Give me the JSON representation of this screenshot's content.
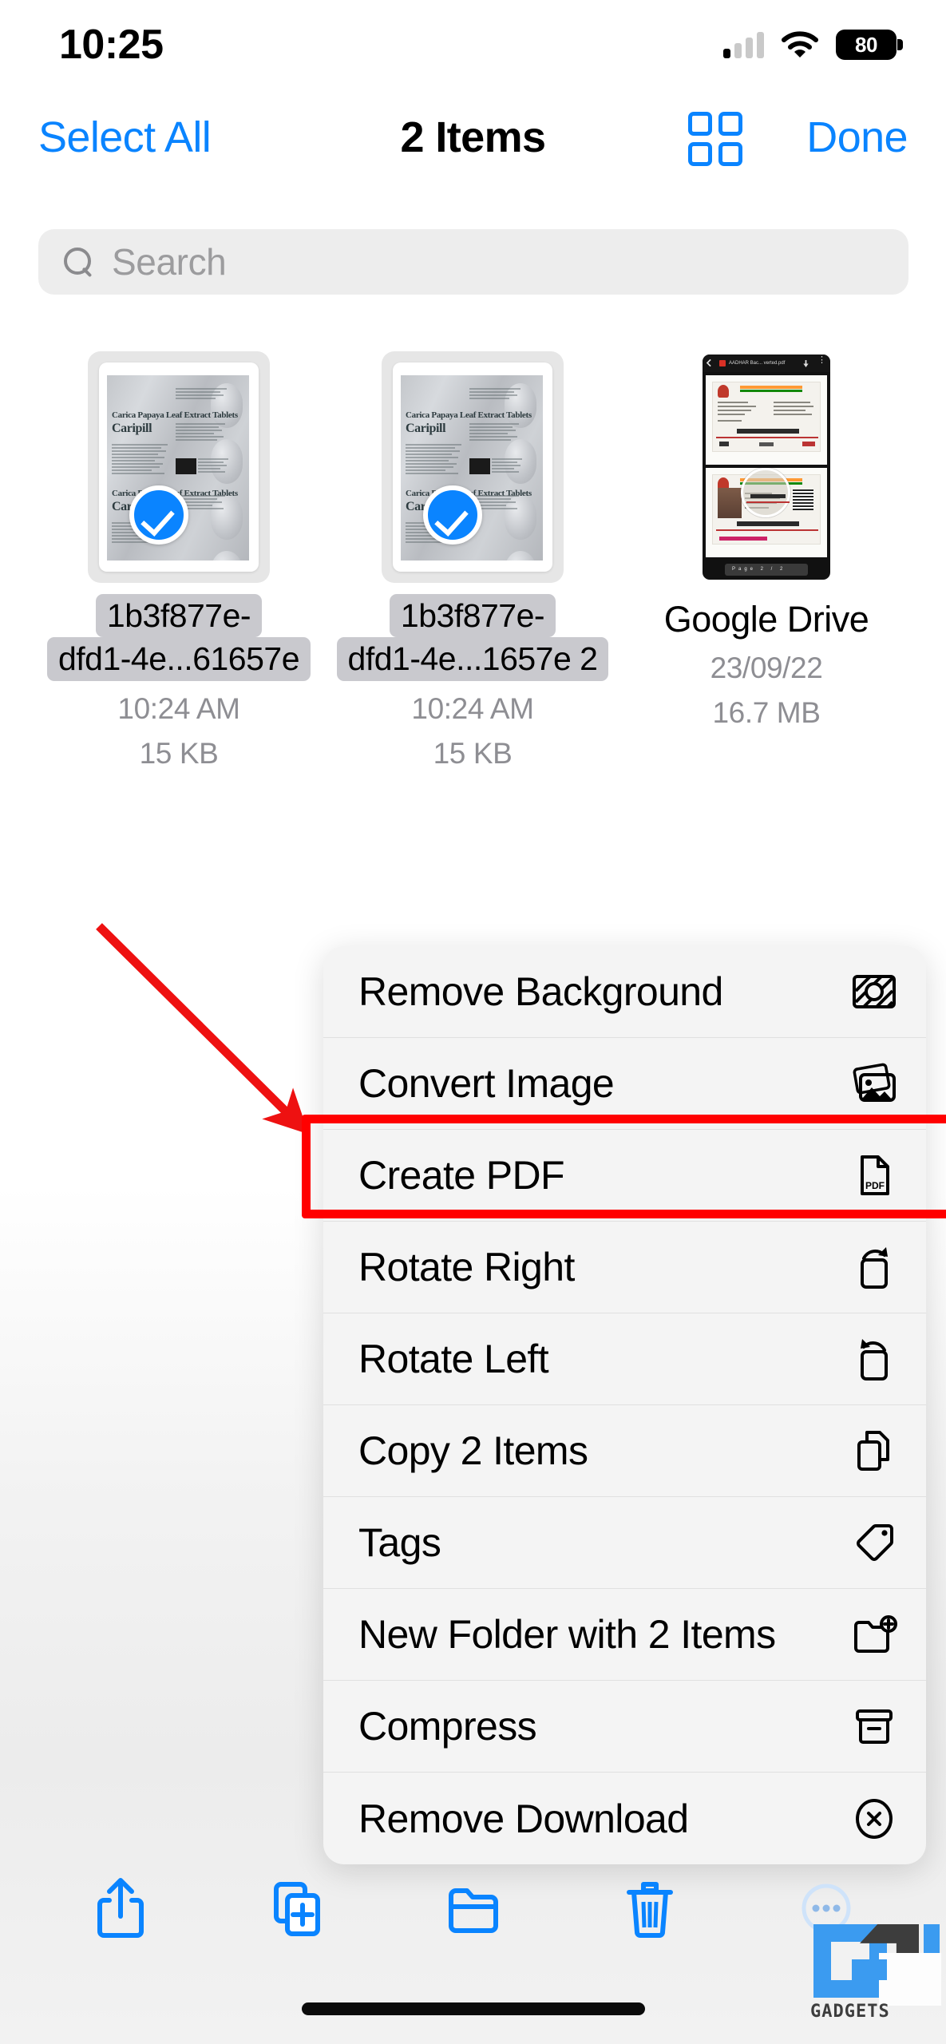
{
  "status_bar": {
    "time": "10:25",
    "battery_level": "80",
    "cellular_icon": "cellular-signal-icon",
    "wifi_icon": "wifi-icon",
    "battery_icon": "battery-icon"
  },
  "nav_bar": {
    "select_all_label": "Select All",
    "title": "2 Items",
    "grid_view_icon": "grid-view-icon",
    "done_label": "Done"
  },
  "search": {
    "placeholder": "Search",
    "icon": "search-icon"
  },
  "files": [
    {
      "name_line1": "1b3f877e-",
      "name_line2": "dfd1-4e...61657e",
      "time": "10:24 AM",
      "size": "15 KB",
      "selected": true,
      "thumbnail": "pill-blister-photo"
    },
    {
      "name_line1": "1b3f877e-",
      "name_line2": "dfd1-4e...1657e 2",
      "time": "10:24 AM",
      "size": "15 KB",
      "selected": true,
      "thumbnail": "pill-blister-photo"
    },
    {
      "name_line1": "Google Drive",
      "name_line2": "",
      "time": "23/09/22",
      "size": "16.7 MB",
      "selected": false,
      "thumbnail": "aadhaar-pdf-screenshot"
    }
  ],
  "context_menu": {
    "items": [
      {
        "label": "Remove Background",
        "icon": "remove-background-icon",
        "highlighted": false
      },
      {
        "label": "Convert Image",
        "icon": "convert-image-icon",
        "highlighted": false
      },
      {
        "label": "Create PDF",
        "icon": "create-pdf-icon",
        "highlighted": true
      },
      {
        "label": "Rotate Right",
        "icon": "rotate-right-icon",
        "highlighted": false
      },
      {
        "label": "Rotate Left",
        "icon": "rotate-left-icon",
        "highlighted": false
      },
      {
        "label": "Copy 2 Items",
        "icon": "copy-icon",
        "highlighted": false
      },
      {
        "label": "Tags",
        "icon": "tag-icon",
        "highlighted": false
      },
      {
        "label": "New Folder with 2 Items",
        "icon": "new-folder-icon",
        "highlighted": false
      },
      {
        "label": "Compress",
        "icon": "compress-icon",
        "highlighted": false
      },
      {
        "label": "Remove Download",
        "icon": "remove-download-icon",
        "highlighted": false
      }
    ]
  },
  "annotations": {
    "arrow_color": "#ff0000",
    "highlight_color": "#ff0000",
    "highlight_target": "Create PDF"
  },
  "bottom_toolbar": {
    "buttons": [
      {
        "icon": "share-icon"
      },
      {
        "icon": "duplicate-icon"
      },
      {
        "icon": "move-to-folder-icon"
      },
      {
        "icon": "delete-icon"
      },
      {
        "icon": "more-actions-icon"
      }
    ]
  },
  "watermark": {
    "text": "GADGETS",
    "brand_color": "#3b9bf0"
  },
  "theme": {
    "accent_blue": "#0a84ff",
    "menu_background": "#f4f4f4",
    "chip_background": "#c9c9ce",
    "meta_text": "#8e8e93"
  }
}
